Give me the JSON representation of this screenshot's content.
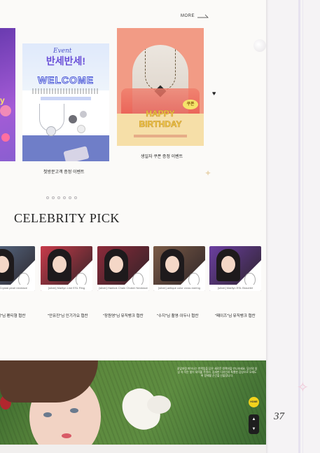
{
  "header": {
    "more_label": "MORE"
  },
  "events": [
    {
      "script": "Event",
      "title": "반세반세!",
      "welcome": "WELCOME",
      "caption": "첫방문고객 증정 이벤트"
    },
    {
      "happy": "HAPPY",
      "birthday": "BIRTHDAY",
      "badge": "쿠폰",
      "caption": "생일자 쿠폰 증정 이벤트"
    }
  ],
  "carousel": {
    "dot_count": 6
  },
  "celebrity": {
    "title": "CELEBRITY PICK",
    "items": [
      {
        "product": "[silver] Crystal pearl necklace",
        "caption": "\"지\"님 펜티형 협찬",
        "photo_color": "#5a6f8c"
      },
      {
        "product": "[silver] Marilyn Line ESL Ring",
        "caption": "\"안유진\"님 인기가요 협찬",
        "photo_color": "#c73b4a"
      },
      {
        "product": "[silver] Hanbok Chain Choker Necklace",
        "caption": "\"장원영\"님 뮤직뱅크 협찬",
        "photo_color": "#8c2a3a"
      },
      {
        "product": "[silver] antique color cross earring",
        "caption": "\"수지\"님 촬영·이두나 협찬",
        "photo_color": "#7a5a46"
      },
      {
        "product": "[silver] Marilyn ESL Bracelet",
        "caption": "\"페이즈\"님 뮤직뱅크 협찬",
        "photo_color": "#6b3fa0"
      }
    ]
  },
  "banner": {
    "blurb": "꽃잎처럼 피어나는 반짝임을 담은 새로운 컬렉션을 만나보세요. 당신의 일상 속 작은 빛이 되어줄 주얼리, 섬세한 디자인과 특별한 감성으로 오래도록 함께할 순간을 선물합니다."
  },
  "side_buttons": {
    "home_label": "HOME",
    "up": "▲",
    "down": "▼"
  },
  "page_number": "37"
}
